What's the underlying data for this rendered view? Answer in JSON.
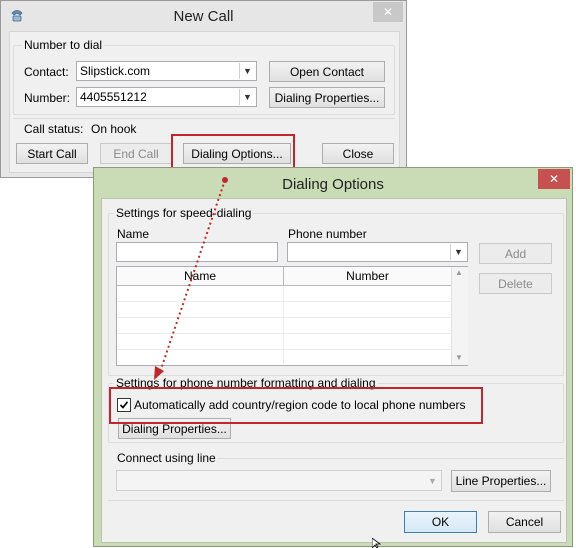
{
  "new_call": {
    "title": "New Call",
    "group_label": "Number to dial",
    "contact_label": "Contact:",
    "contact_value": "Slipstick.com",
    "number_label": "Number:",
    "number_value": "4405551212",
    "open_contact": "Open Contact",
    "dialing_properties": "Dialing Properties...",
    "call_status_label": "Call status:",
    "call_status_value": "On hook",
    "start_call": "Start Call",
    "end_call": "End Call",
    "dialing_options": "Dialing Options...",
    "close": "Close",
    "close_x": "✕"
  },
  "dialing_options": {
    "title": "Dialing Options",
    "close_x": "✕",
    "speed_group": "Settings for speed-dialing",
    "name_label": "Name",
    "phone_label": "Phone number",
    "add": "Add",
    "delete": "Delete",
    "col_name": "Name",
    "col_number": "Number",
    "format_group": "Settings for phone number formatting and dialing",
    "auto_add_label": "Automatically add country/region code to local phone numbers",
    "auto_add_checked": true,
    "dialing_properties": "Dialing Properties...",
    "connect_group": "Connect using line",
    "line_properties": "Line Properties...",
    "ok": "OK",
    "cancel": "Cancel"
  },
  "colors": {
    "annotation_red": "#c0272d",
    "chrome_green": "#c9dcb5",
    "chrome_gray": "#e3e3e3",
    "close_red": "#c75050"
  }
}
